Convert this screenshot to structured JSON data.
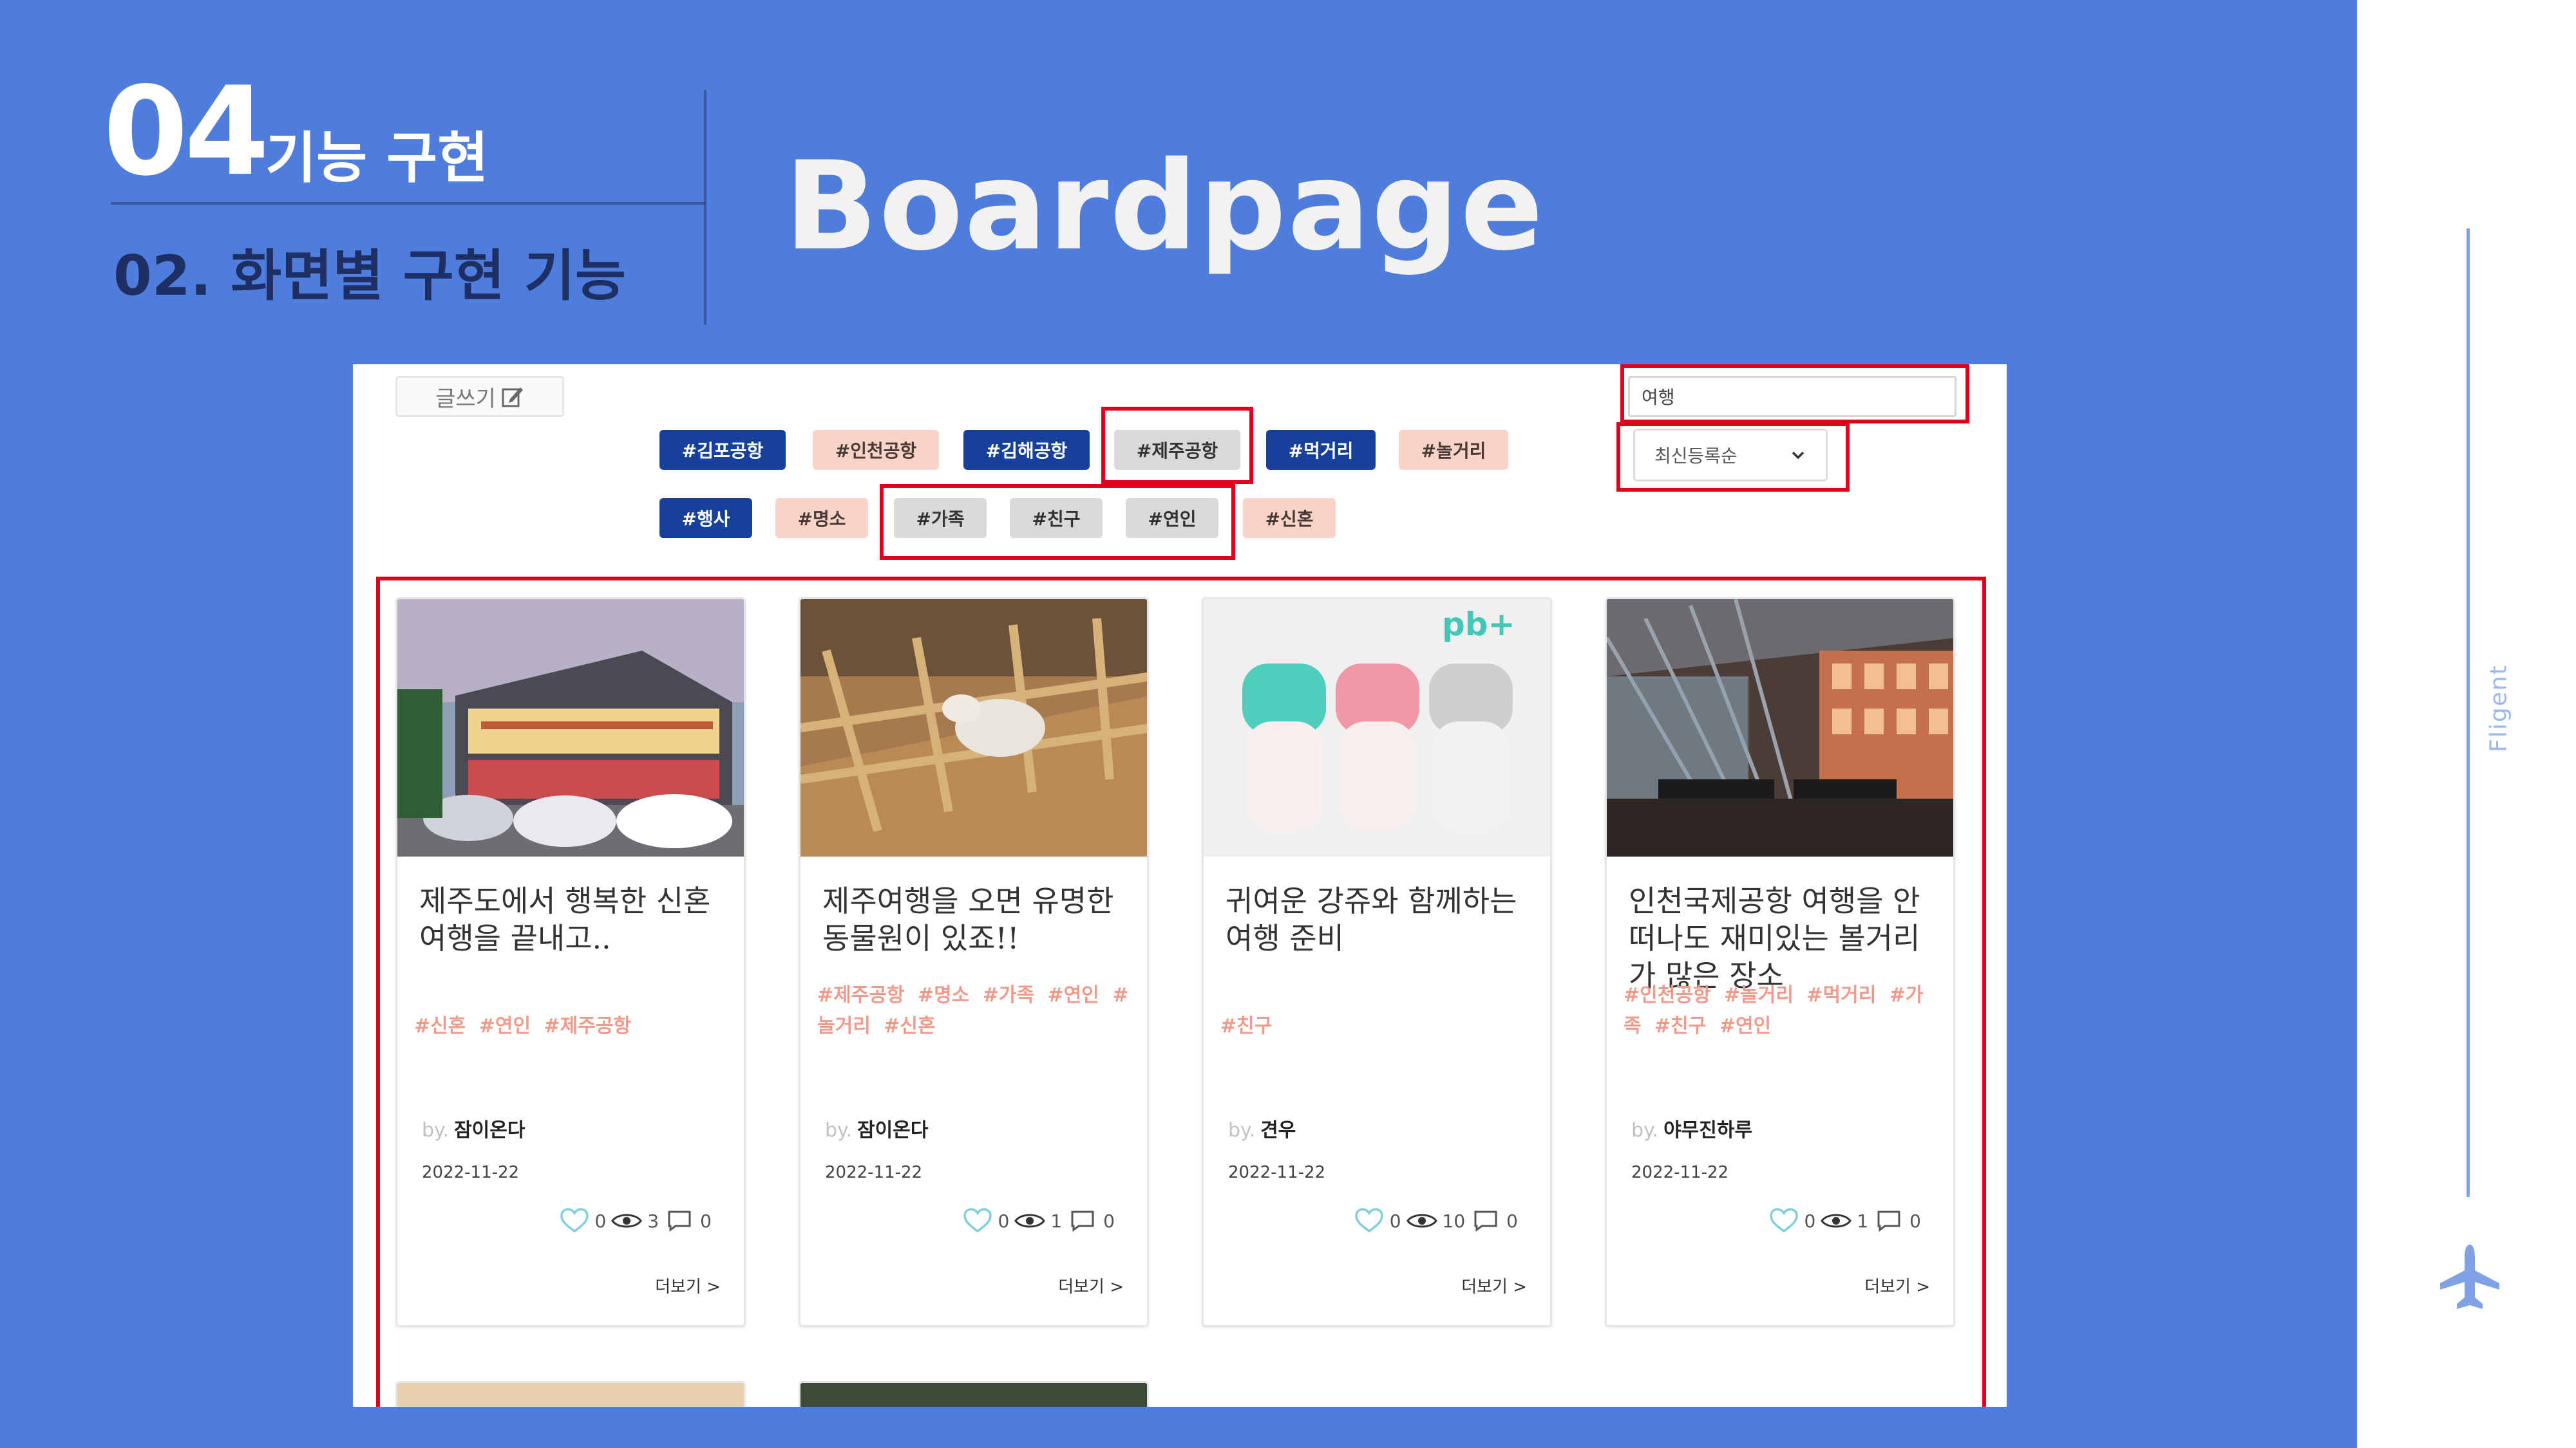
{
  "header": {
    "section_number": "04",
    "section_title": "기능 구현",
    "subtitle": "02. 화면별 구현 기능",
    "page_title": "Boardpage"
  },
  "sidebar": {
    "brand": "Fligent"
  },
  "toolbar": {
    "write_label": "글쓰기",
    "search_value": "여행",
    "sort_selected": "최신등록순"
  },
  "tags_row1": [
    {
      "label": "#김포공항",
      "style": "navy"
    },
    {
      "label": "#인천공항",
      "style": "pink"
    },
    {
      "label": "#김해공항",
      "style": "navy"
    },
    {
      "label": "#제주공항",
      "style": "gray"
    },
    {
      "label": "#먹거리",
      "style": "navy"
    },
    {
      "label": "#놀거리",
      "style": "pink"
    }
  ],
  "tags_row2": [
    {
      "label": "#행사",
      "style": "navy"
    },
    {
      "label": "#명소",
      "style": "pink"
    },
    {
      "label": "#가족",
      "style": "gray"
    },
    {
      "label": "#친구",
      "style": "gray"
    },
    {
      "label": "#연인",
      "style": "gray"
    },
    {
      "label": "#신혼",
      "style": "pink"
    }
  ],
  "cards": [
    {
      "title": "제주도에서 행복한 신혼여행을 끝내고..",
      "tags": "#신혼 #연인 #제주공항",
      "by": "by.",
      "author": "잠이온다",
      "date": "2022-11-22",
      "likes": "0",
      "views": "3",
      "comments": "0",
      "more": "더보기 >"
    },
    {
      "title": "제주여행을 오면 유명한 동물원이 있죠!!",
      "tags": "#제주공항 #명소 #가족 #연인 #놀거리 #신혼",
      "by": "by.",
      "author": "잠이온다",
      "date": "2022-11-22",
      "likes": "0",
      "views": "1",
      "comments": "0",
      "more": "더보기 >"
    },
    {
      "title": "귀여운 강쥬와 함께하는 여행 준비",
      "tags": "#친구",
      "by": "by.",
      "author": "견우",
      "date": "2022-11-22",
      "likes": "0",
      "views": "10",
      "comments": "0",
      "more": "더보기 >",
      "image_brand": "pb+"
    },
    {
      "title": "인천국제공항 여행을 안 떠나도 재미있는 볼거리가 많은 장소",
      "tags": "#인천공항 #놀거리 #먹거리 #가족 #친구 #연인",
      "by": "by.",
      "author": "야무진하루",
      "date": "2022-11-22",
      "likes": "0",
      "views": "1",
      "comments": "0",
      "more": "더보기 >"
    }
  ],
  "colors": {
    "background": "#4f7ddd",
    "navy_tag": "#16409a",
    "pink_tag": "#f7d3c8",
    "gray_tag": "#d9d9d9",
    "highlight_box": "#e0001b",
    "tag_text": "#f09a8c"
  },
  "icons": [
    "pencil-icon",
    "chevron-down-icon",
    "heart-icon",
    "eye-icon",
    "comment-icon",
    "plane-icon"
  ]
}
